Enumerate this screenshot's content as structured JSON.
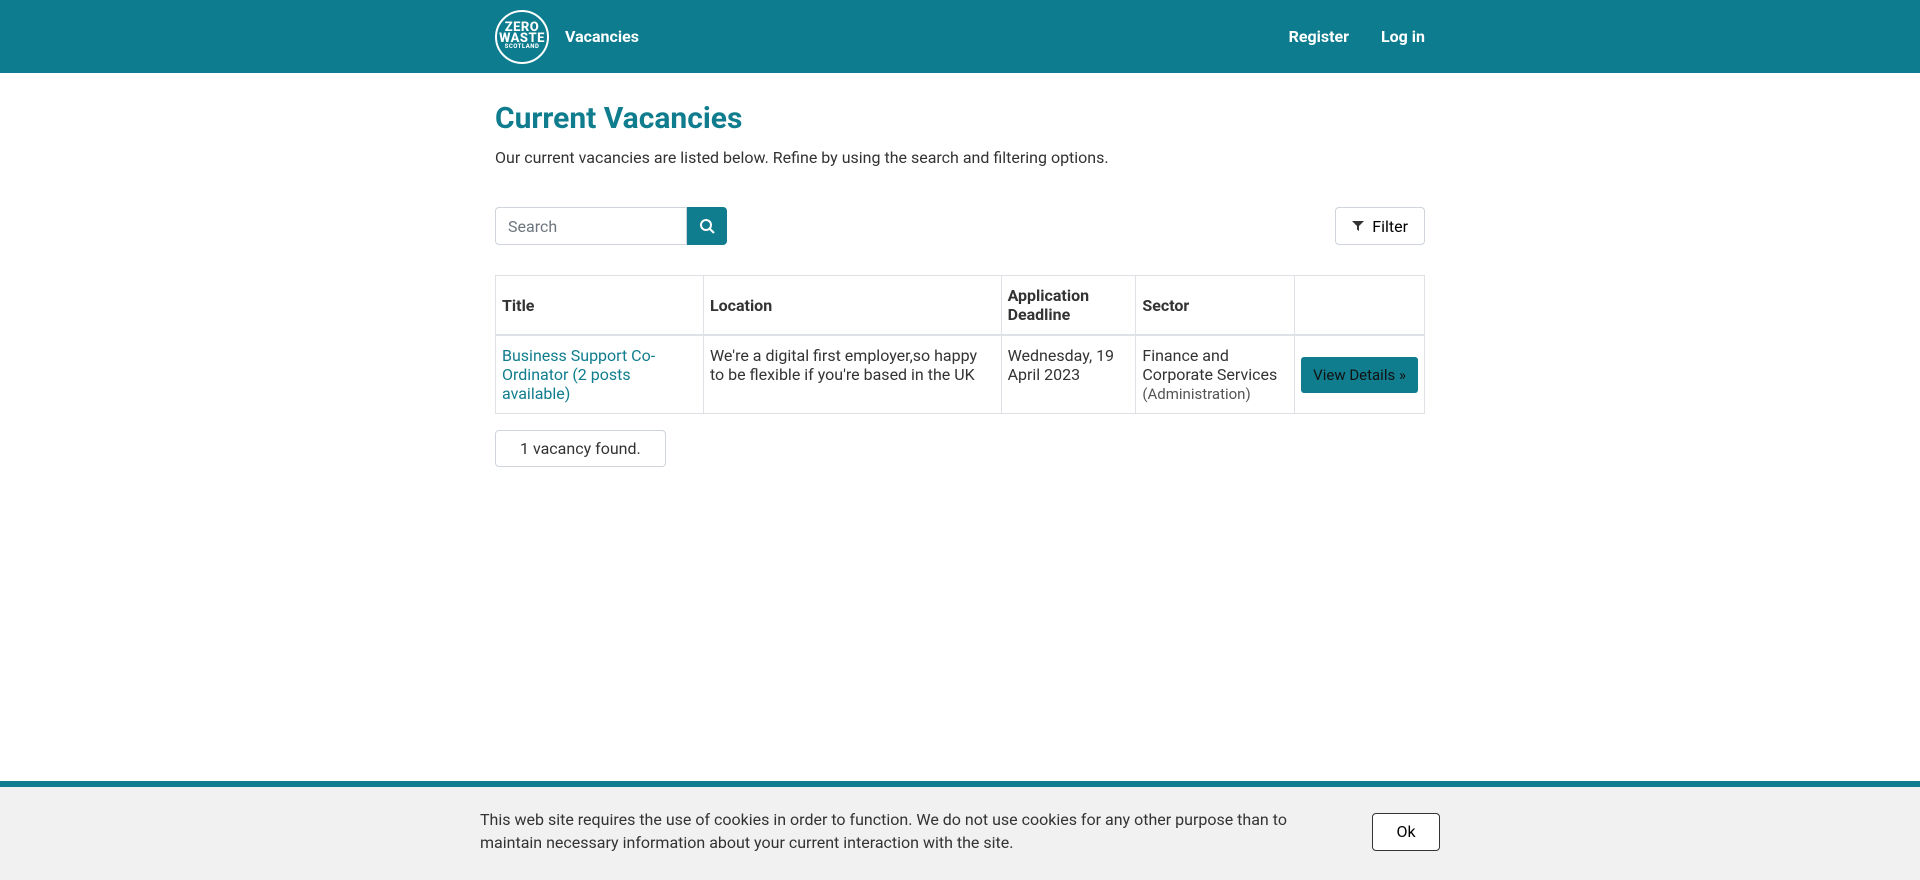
{
  "header": {
    "logo": {
      "line1": "ZERO",
      "line2": "WASTE",
      "line3": "SCOTLAND"
    },
    "nav": {
      "vacancies": "Vacancies"
    },
    "right": {
      "register": "Register",
      "login": "Log in"
    }
  },
  "page": {
    "title": "Current Vacancies",
    "subtitle": "Our current vacancies are listed below. Refine by using the search and filtering options."
  },
  "search": {
    "placeholder": "Search"
  },
  "filter": {
    "label": "Filter"
  },
  "table": {
    "headers": {
      "title": "Title",
      "location": "Location",
      "deadline": "Application Deadline",
      "sector": "Sector"
    },
    "rows": [
      {
        "title": "Business Support Co-Ordinator (2 posts available)",
        "location": "We're a digital first employer,so happy to be flexible if you're based in the UK",
        "deadline": "Wednesday, 19 April 2023",
        "sector_main": "Finance and Corporate Services",
        "sector_sub": "(Administration)",
        "action": "View Details »"
      }
    ]
  },
  "result_count": "1 vacancy found.",
  "cookie": {
    "text": "This web site requires the use of cookies in order to function. We do not use cookies for any other purpose than to maintain necessary information about your current interaction with the site.",
    "ok": "Ok"
  }
}
